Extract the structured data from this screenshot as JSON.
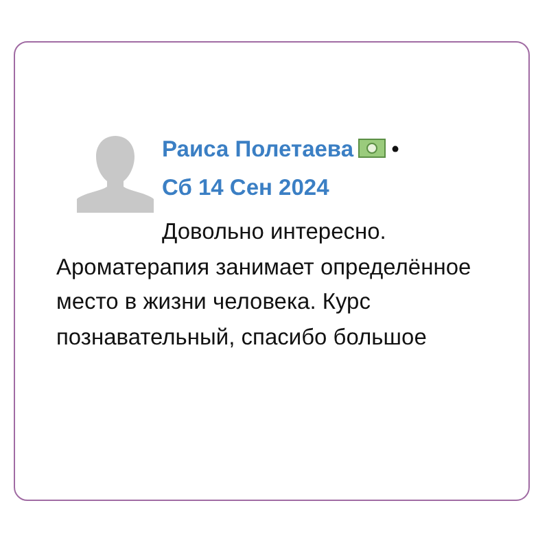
{
  "review": {
    "author": "Раиса Полетаева",
    "separator": "•",
    "date": "Сб 14 Сен 2024",
    "text": "Довольно интересно. Ароматерапия занимает определённое место в жизни человека. Курс познавательный, спасибо большое"
  }
}
